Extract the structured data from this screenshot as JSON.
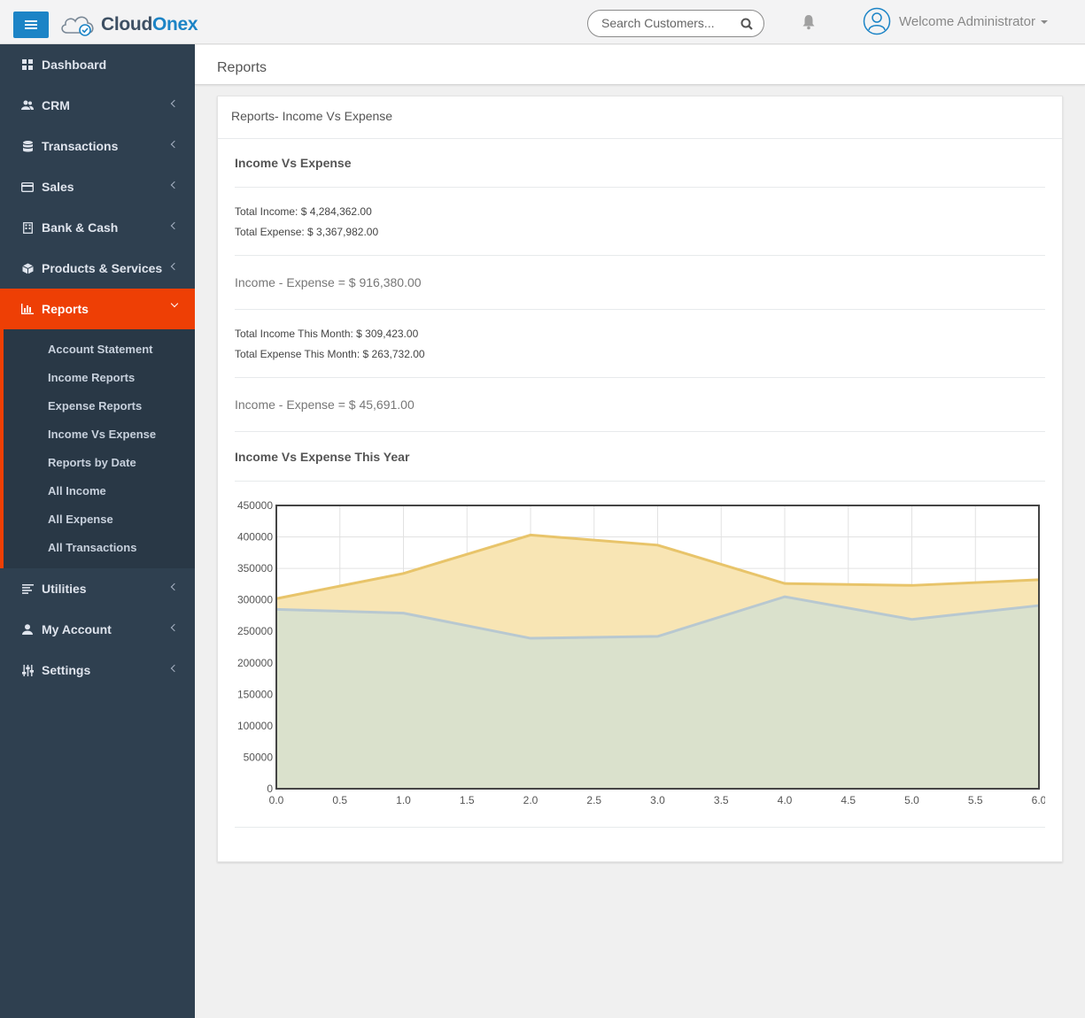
{
  "topbar": {
    "logo_part1": "Cloud",
    "logo_part2": "Onex",
    "search_placeholder": "Search Customers...",
    "welcome": "Welcome Administrator"
  },
  "colors": {
    "sidebar_bg": "#2f4050",
    "active": "#ee3f05",
    "accent": "#1c84c6",
    "income_fill": "#f8e5b4",
    "income_line": "#e8c46a",
    "expense_fill": "#d8e0cd",
    "expense_line": "#b8c8d0"
  },
  "sidebar": {
    "items": [
      {
        "label": "Dashboard",
        "icon": "dashboard-icon"
      },
      {
        "label": "CRM",
        "icon": "users-icon"
      },
      {
        "label": "Transactions",
        "icon": "database-icon"
      },
      {
        "label": "Sales",
        "icon": "credit-card-icon"
      },
      {
        "label": "Bank & Cash",
        "icon": "building-icon"
      },
      {
        "label": "Products & Services",
        "icon": "cube-icon"
      },
      {
        "label": "Reports",
        "icon": "bar-chart-icon"
      },
      {
        "label": "Utilities",
        "icon": "align-left-icon"
      },
      {
        "label": "My Account",
        "icon": "user-icon"
      },
      {
        "label": "Settings",
        "icon": "sliders-icon"
      }
    ],
    "reports_submenu": [
      "Account Statement",
      "Income Reports",
      "Expense Reports",
      "Income Vs Expense",
      "Reports by Date",
      "All Income",
      "All Expense",
      "All Transactions"
    ]
  },
  "page": {
    "title": "Reports",
    "panel_title": "Reports- Income Vs Expense",
    "heading": "Income Vs Expense",
    "total_income": "Total Income: $ 4,284,362.00",
    "total_expense": "Total Expense: $ 3,367,982.00",
    "diff_total": "Income - Expense = $ 916,380.00",
    "month_income": "Total Income This Month: $ 309,423.00",
    "month_expense": "Total Expense This Month: $ 263,732.00",
    "diff_month": "Income - Expense = $ 45,691.00",
    "chart_heading": "Income Vs Expense This Year"
  },
  "chart_data": {
    "type": "area",
    "x": [
      0,
      1,
      2,
      3,
      4,
      5,
      6
    ],
    "series": [
      {
        "values": [
          302000,
          342000,
          403000,
          387000,
          326000,
          323000,
          332000
        ]
      },
      {
        "values": [
          285000,
          279000,
          239000,
          242000,
          305000,
          269000,
          291000
        ]
      }
    ],
    "xlim": [
      0,
      6
    ],
    "ylim": [
      0,
      450000
    ],
    "x_ticks": [
      "0.0",
      "0.5",
      "1.0",
      "1.5",
      "2.0",
      "2.5",
      "3.0",
      "3.5",
      "4.0",
      "4.5",
      "5.0",
      "5.5",
      "6.0"
    ],
    "y_ticks": [
      "0",
      "50000",
      "100000",
      "150000",
      "200000",
      "250000",
      "300000",
      "350000",
      "400000",
      "450000"
    ],
    "grid": true
  }
}
